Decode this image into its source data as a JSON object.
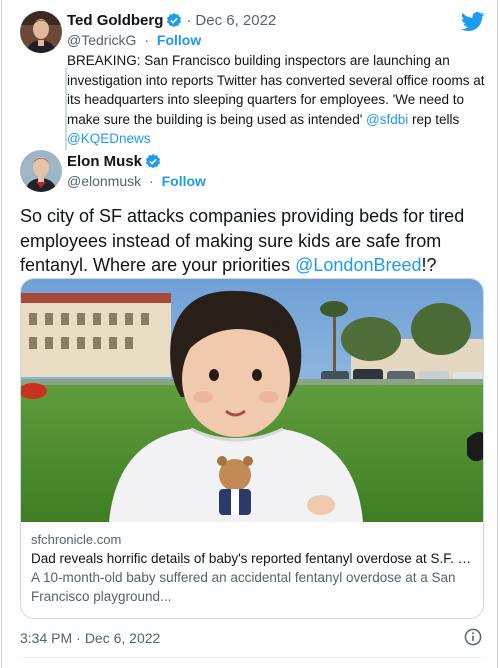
{
  "brand": {
    "color": "#1d9bf0",
    "icon": "twitter-bird-icon"
  },
  "quoted_tweet": {
    "author_name": "Ted Goldberg",
    "handle": "@TedrickG",
    "date": "Dec 6, 2022",
    "follow_label": "Follow",
    "text_before": "BREAKING: San Francisco building inspectors are launching an investigation into reports Twitter has  converted several office rooms at its headquarters into sleeping quarters for employees. 'We need to make sure the building is being used as intended' ",
    "mention_1": "@sfdbi",
    "text_middle": " rep tells ",
    "mention_2": "@KQEDnews"
  },
  "tweet": {
    "author_name": "Elon Musk",
    "handle": "@elonmusk",
    "follow_label": "Follow",
    "text_before": "So city of SF attacks companies providing beds for tired employees instead of making sure kids are safe from fentanyl. Where are your priorities ",
    "mention": "@LondonBreed",
    "text_after": "!?",
    "time": "3:34 PM",
    "date": "Dec 6, 2022"
  },
  "card": {
    "domain": "sfchronicle.com",
    "title": "Dad reveals horrific details of baby's reported fentanyl overdose at S.F. p...",
    "description": "A 10-month-old baby suffered an accidental fentanyl overdose at a San Francisco playground..."
  }
}
